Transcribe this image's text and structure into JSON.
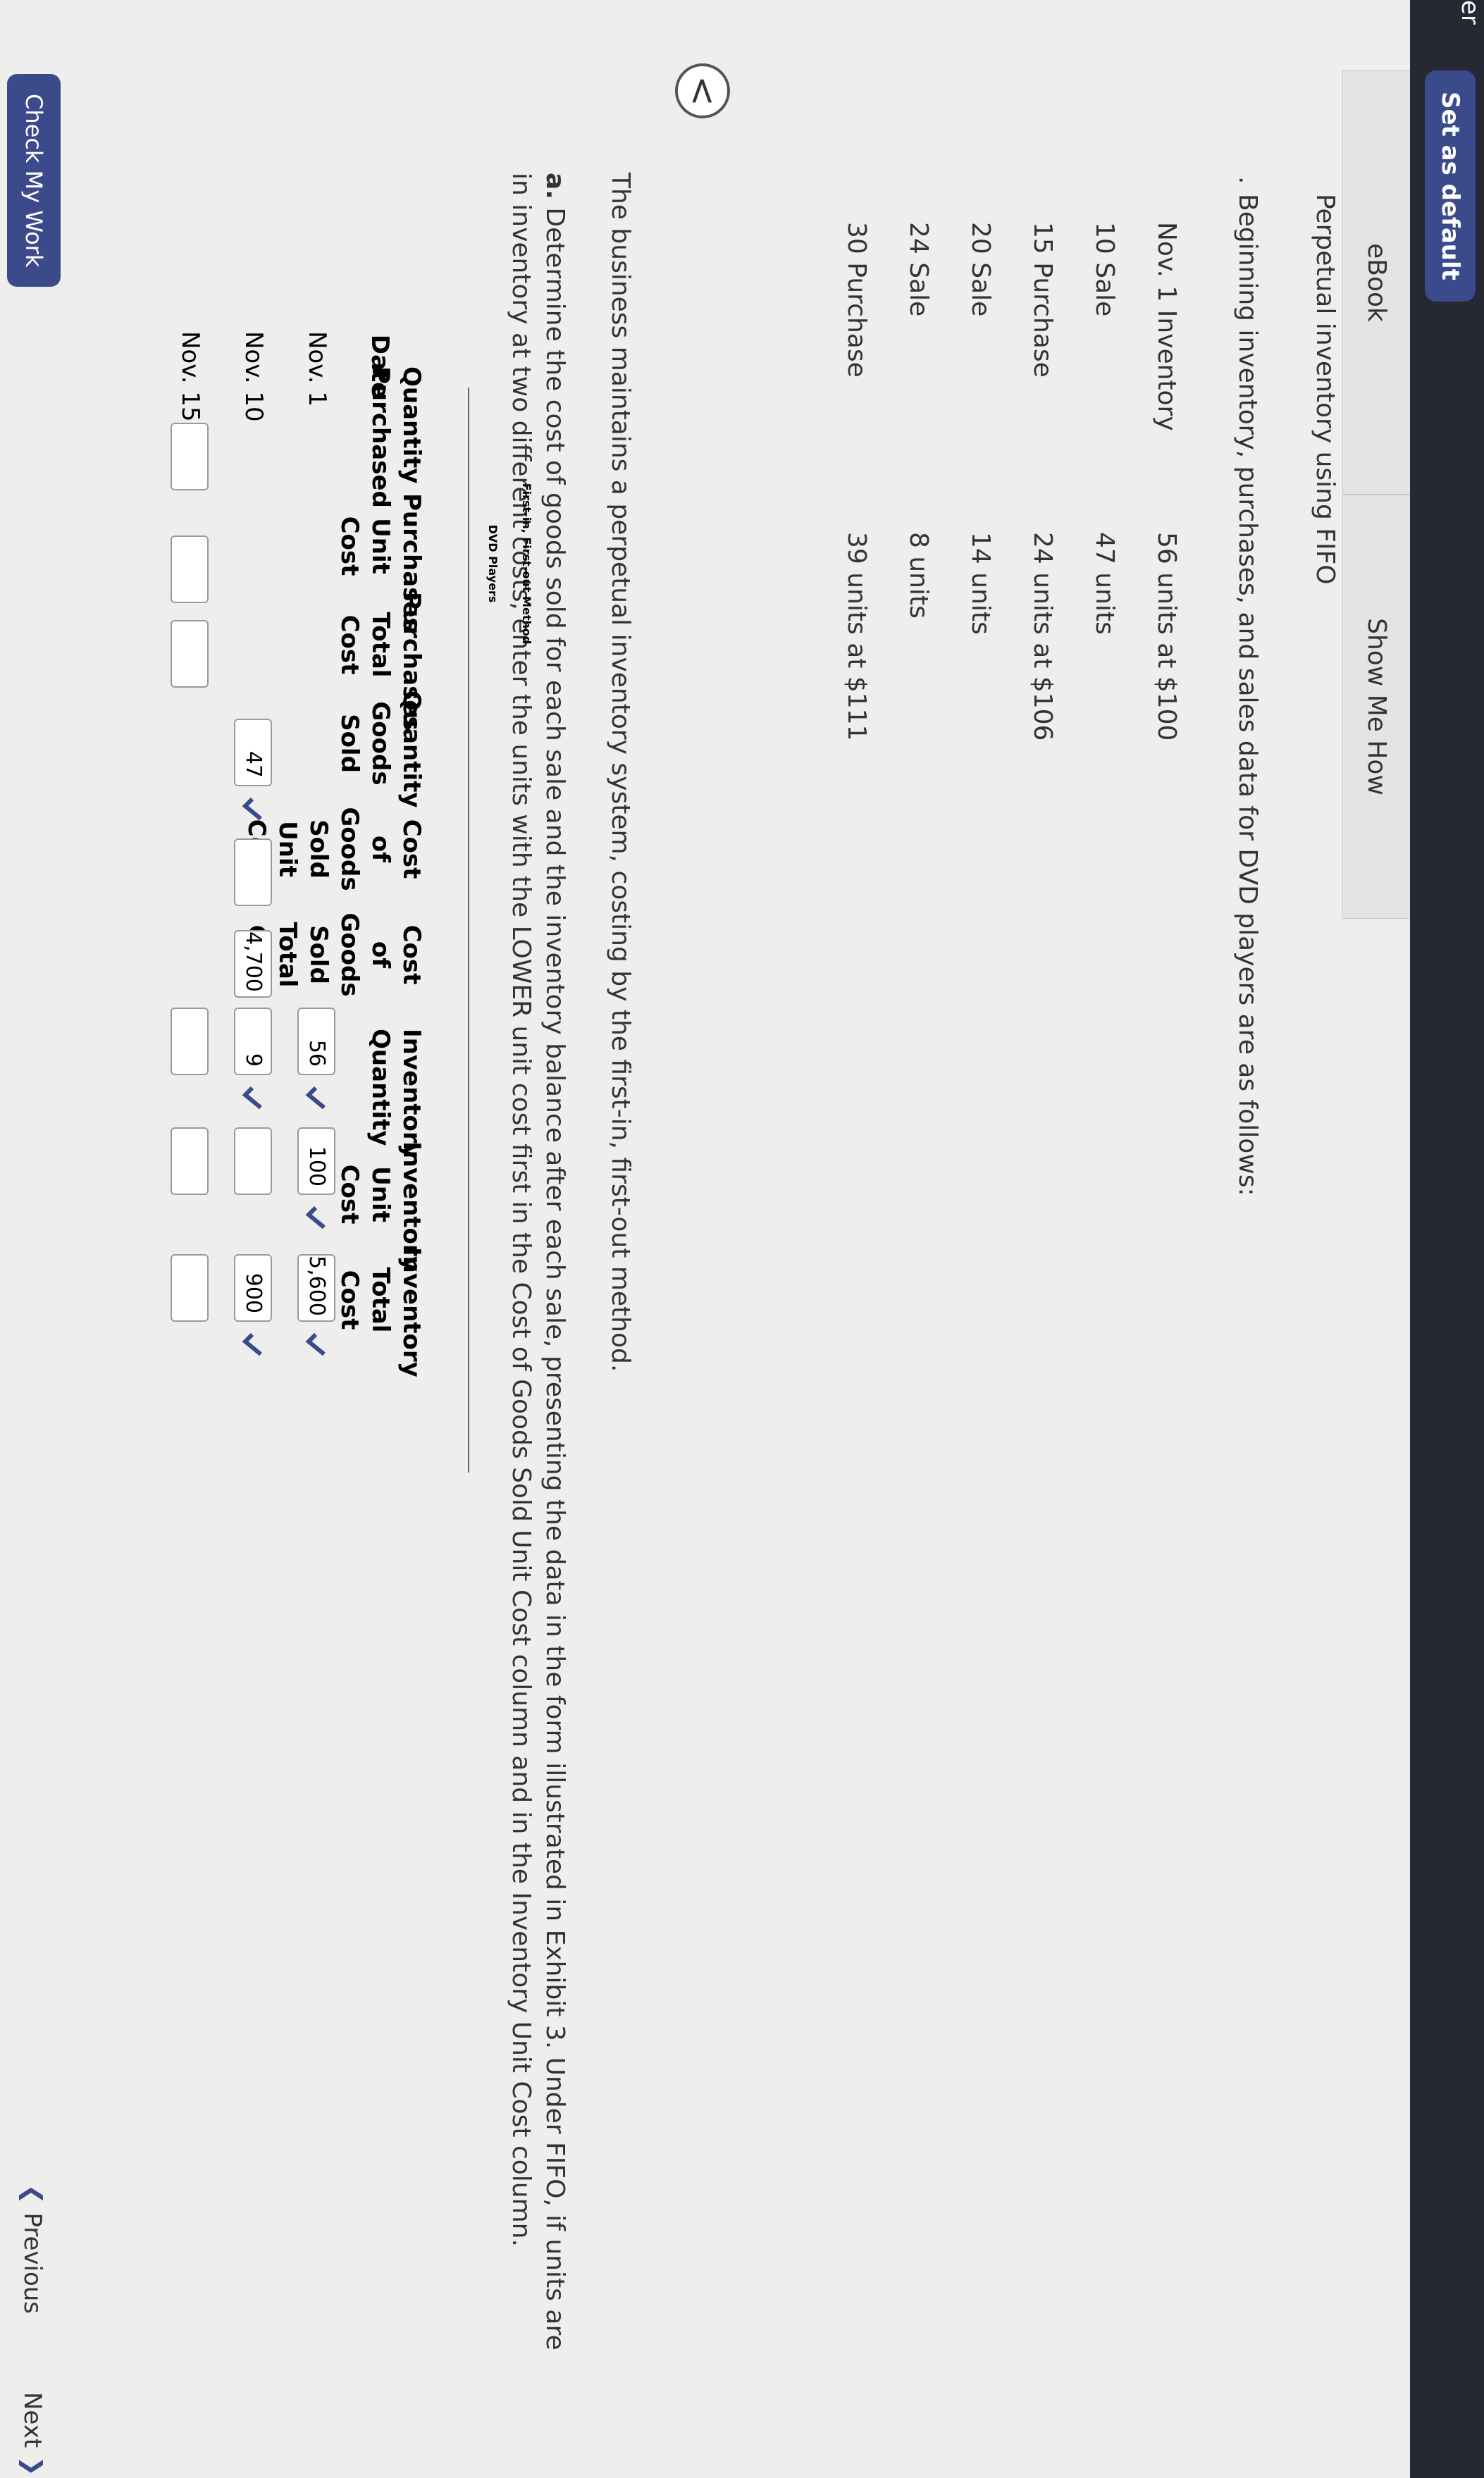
{
  "topbar": {
    "cut_text": "er",
    "set_default_label": "Set as default"
  },
  "tabs": [
    {
      "label": "eBook"
    },
    {
      "label": "Show Me How"
    }
  ],
  "problem": {
    "title": "Perpetual inventory using FIFO",
    "bullet": ".",
    "intro": "Beginning inventory, purchases, and sales data for DVD players are as follows:",
    "data_rows": [
      {
        "a": "Nov. 1 Inventory",
        "b": "56 units at $100"
      },
      {
        "a": "10 Sale",
        "b": "47 units"
      },
      {
        "a": "15 Purchase",
        "b": "24 units at $106"
      },
      {
        "a": "20 Sale",
        "b": "14 units"
      },
      {
        "a": "24 Sale",
        "b": "8 units"
      },
      {
        "a": "30 Purchase",
        "b": "39 units at $111"
      }
    ],
    "business_text": "The business maintains a perpetual inventory system, costing by the first-in, first-out method.",
    "question_label": "a.",
    "question_text": "Determine the cost of goods sold for each sale and the inventory balance after each sale, presenting the data in the form illustrated in Exhibit 3. Under FIFO, if units are in inventory at two different costs, enter the units with the LOWER unit cost first in the Cost of Goods Sold Unit Cost column and in the Inventory Unit Cost column."
  },
  "back_arrow": "<",
  "table": {
    "title1": "First-in, First-out Method",
    "title2": "DVD Players",
    "headers": [
      "Date",
      "Quantity Purchased",
      "Purchases Unit Cost",
      "Purchases Total Cost",
      "Quantity Goods Sold",
      "Cost of Goods Sold Unit Cost",
      "Cost of Goods Sold Total Cost",
      "Inventory Quantity",
      "Inventory Unit Cost",
      "Inventory Total Cost"
    ],
    "rows": [
      {
        "date": "Nov. 1",
        "inv_qty": "56",
        "inv_unit": "100",
        "inv_total": "5,600"
      },
      {
        "date": "Nov. 10",
        "sold_qty": "47",
        "cogs_total": "4,700",
        "inv_qty": "9",
        "inv_total": "900"
      },
      {
        "date": "Nov. 15"
      }
    ]
  },
  "footer": {
    "check_work": "Check My Work",
    "previous": "Previous",
    "next": "Next"
  },
  "colors": {
    "accent": "#3b4a8a",
    "check": "#3a4a8c",
    "topbar": "#262834"
  }
}
